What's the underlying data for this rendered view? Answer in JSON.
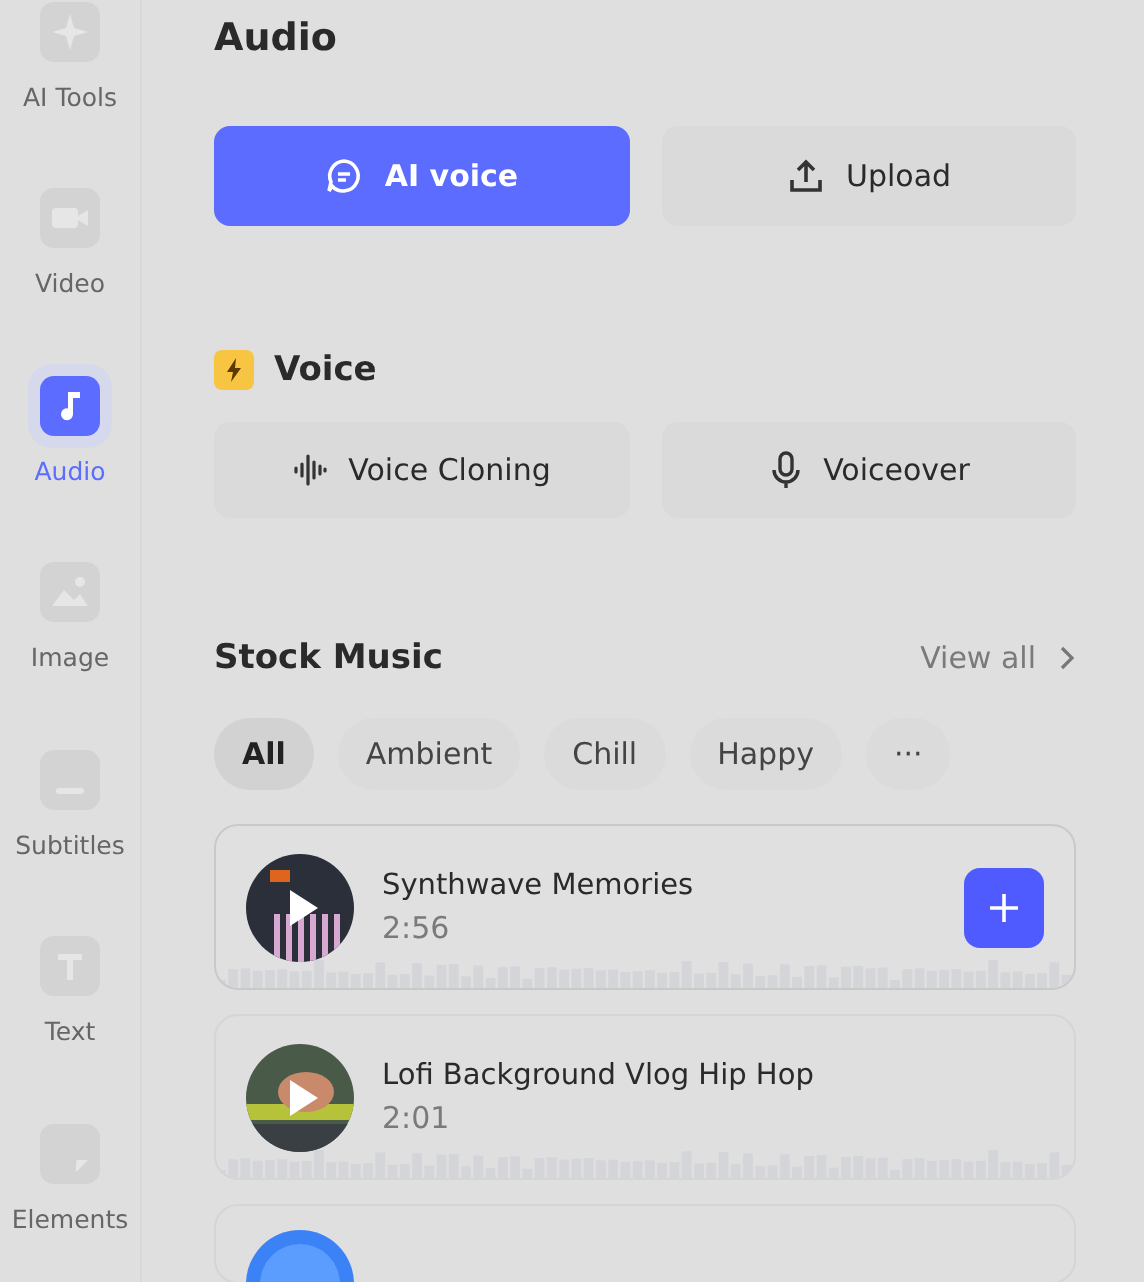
{
  "sidebar": {
    "items": [
      {
        "label": "AI Tools",
        "selected": false
      },
      {
        "label": "Video",
        "selected": false
      },
      {
        "label": "Audio",
        "selected": true
      },
      {
        "label": "Image",
        "selected": false
      },
      {
        "label": "Subtitles",
        "selected": false
      },
      {
        "label": "Text",
        "selected": false
      },
      {
        "label": "Elements",
        "selected": false
      }
    ]
  },
  "title": "Audio",
  "source_tabs": [
    {
      "label": "AI voice",
      "selected": true
    },
    {
      "label": "Upload",
      "selected": false
    }
  ],
  "voice": {
    "heading": "Voice",
    "buttons": [
      {
        "label": "Voice Cloning"
      },
      {
        "label": "Voiceover"
      }
    ]
  },
  "stock_music": {
    "heading": "Stock Music",
    "view_all": "View all",
    "chips": [
      {
        "label": "All",
        "selected": true
      },
      {
        "label": "Ambient",
        "selected": false
      },
      {
        "label": "Chill",
        "selected": false
      },
      {
        "label": "Happy",
        "selected": false
      },
      {
        "label": "···",
        "selected": false
      }
    ],
    "tracks": [
      {
        "kind": "track",
        "title": "Synthwave Memories",
        "duration": "2:56",
        "hovered": true
      },
      {
        "kind": "track",
        "title": "Lofi Background Vlog Hip Hop",
        "duration": "2:01",
        "hovered": false
      },
      {
        "kind": "partial",
        "hovered": false
      }
    ]
  }
}
